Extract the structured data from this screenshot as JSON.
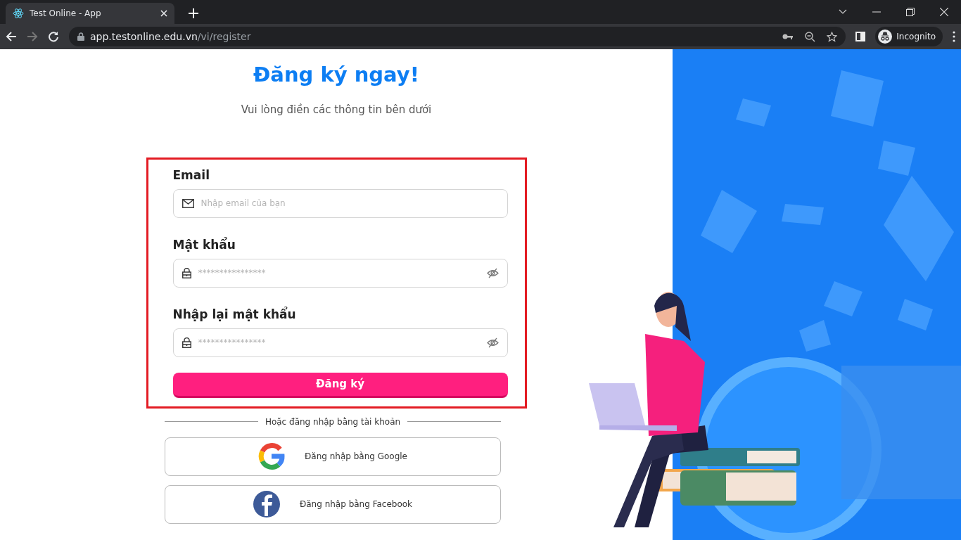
{
  "browser": {
    "tab_title": "Test Online - App",
    "url_host": "app.testonline.edu.vn",
    "url_path": "/vi/register",
    "profile_label": "Incognito"
  },
  "page": {
    "title": "Đăng ký ngay!",
    "subtitle": "Vui lòng điền các thông tin bên dưới"
  },
  "form": {
    "fields": [
      {
        "kind": "email",
        "label": "Email",
        "placeholder": "Nhập email của bạn"
      },
      {
        "kind": "password",
        "label": "Mật khẩu",
        "placeholder": "****************"
      },
      {
        "kind": "password",
        "label": "Nhập lại mật khẩu",
        "placeholder": "****************"
      }
    ],
    "submit": "Đăng ký"
  },
  "divider_text": "Hoặc đăng nhập bằng tài khoản",
  "social_buttons": [
    {
      "kind": "google",
      "label": "Đăng nhập bằng Google"
    },
    {
      "kind": "facebook",
      "label": "Đăng nhập bằng Facebook"
    }
  ]
}
